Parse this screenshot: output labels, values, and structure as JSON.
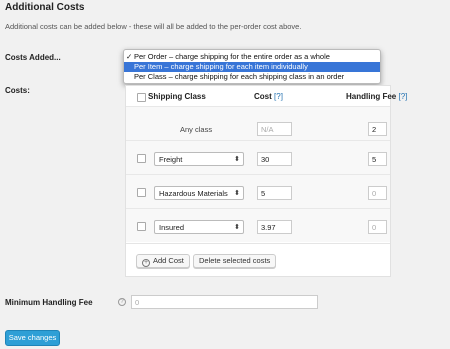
{
  "section": {
    "title": "Additional Costs",
    "description": "Additional costs can be added below - these will all be added to the per-order cost above."
  },
  "costs_added": {
    "label": "Costs Added...",
    "options": [
      {
        "label": "Per Order – charge shipping for the entire order as a whole",
        "checked": true,
        "highlighted": false
      },
      {
        "label": "Per Item – charge shipping for each item individually",
        "checked": false,
        "highlighted": true
      },
      {
        "label": "Per Class – charge shipping for each shipping class in an order",
        "checked": false,
        "highlighted": false
      }
    ],
    "checkmark": "✓"
  },
  "costs": {
    "label": "Costs:",
    "headers": {
      "shipping_class": "Shipping Class",
      "cost": "Cost",
      "cost_help": "[?]",
      "handling_fee": "Handling Fee",
      "handling_help": "[?]"
    },
    "any_class": {
      "label": "Any class",
      "cost_placeholder": "N/A",
      "fee": "2"
    },
    "rows": [
      {
        "class": "Freight",
        "cost": "30",
        "fee": "5",
        "fee_placeholder": false
      },
      {
        "class": "Hazardous Materials",
        "cost": "5",
        "fee": "0",
        "fee_placeholder": true
      },
      {
        "class": "Insured",
        "cost": "3.97",
        "fee": "0",
        "fee_placeholder": true
      }
    ],
    "add_cost_label": "Add Cost",
    "delete_label": "Delete selected costs",
    "select_arrow": "⬍"
  },
  "min_handling_fee": {
    "label": "Minimum Handling Fee",
    "placeholder": "0",
    "help": "?"
  },
  "save_label": "Save changes",
  "colors": {
    "accent": "#2e9fd6",
    "highlight": "#3875d7",
    "link": "#2271b1"
  }
}
